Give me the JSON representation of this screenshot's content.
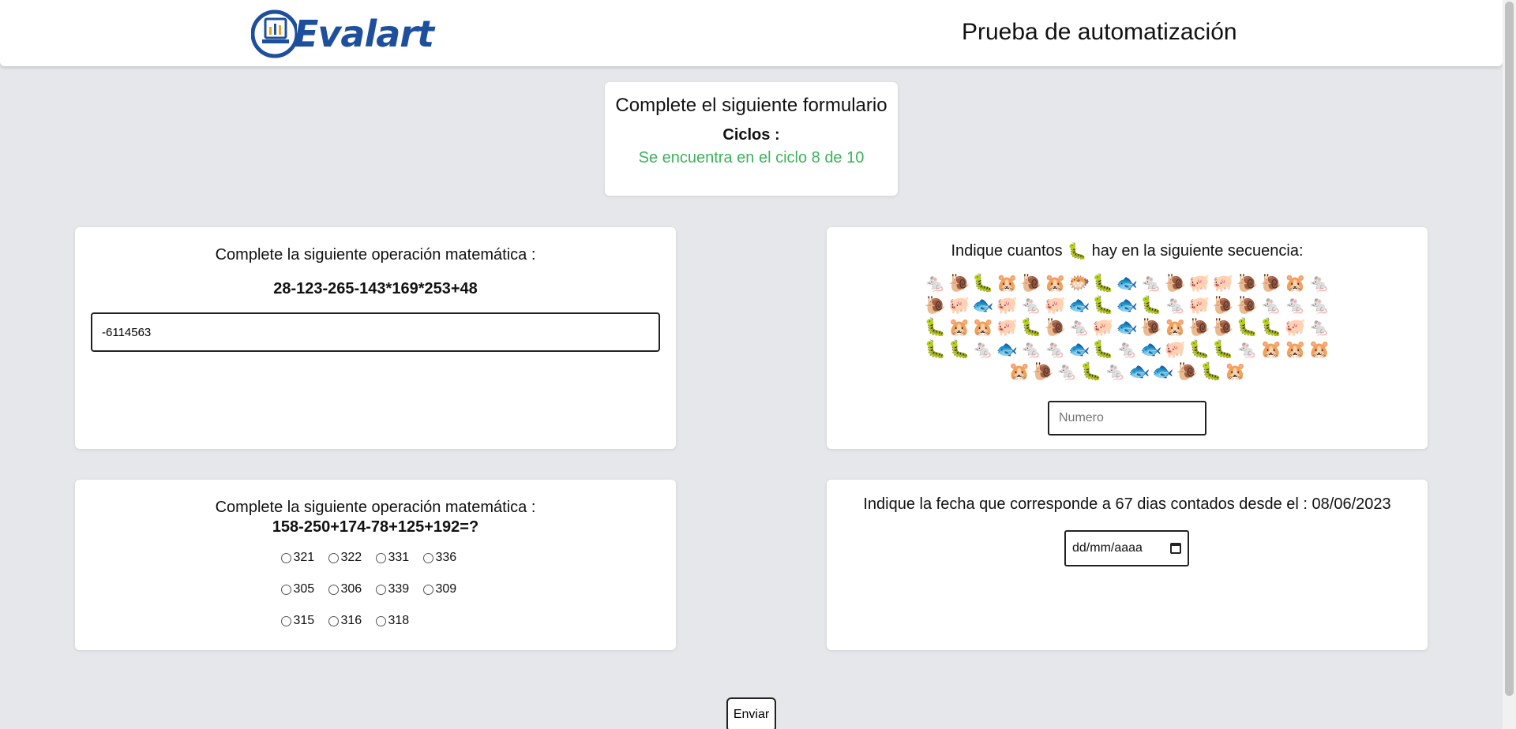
{
  "header": {
    "logo_text": "Evalart",
    "title": "Prueba de automatización"
  },
  "intro": {
    "heading": "Complete el siguiente formulario",
    "ciclos_label": "Ciclos :",
    "ciclos_status": "Se encuentra en el ciclo 8 de 10"
  },
  "math_input": {
    "prompt": "Complete la siguiente operación matemática :",
    "expression": "28-123-265-143*169*253+48",
    "value": "-6114563"
  },
  "sequence": {
    "prompt_before": "Indique cuantos",
    "prompt_icon": "🐛",
    "prompt_after": "hay en la siguiente secuencia:",
    "items": [
      "🐁",
      "🐌",
      "🐛",
      "🐹",
      "🐌",
      "🐹",
      "🐡",
      "🐛",
      "🐟",
      "🐁",
      "🐌",
      "🐖",
      "🐖",
      "🐌",
      "🐌",
      "🐹",
      "🐁",
      "🐌",
      "🐖",
      "🐟",
      "🐖",
      "🐁",
      "🐖",
      "🐟",
      "🐛",
      "🐟",
      "🐛",
      "🐁",
      "🐖",
      "🐌",
      "🐌",
      "🐁",
      "🐁",
      "🐁",
      "🐛",
      "🐹",
      "🐹",
      "🐖",
      "🐛",
      "🐌",
      "🐁",
      "🐖",
      "🐟",
      "🐌",
      "🐹",
      "🐌",
      "🐌",
      "🐛",
      "🐛",
      "🐖",
      "🐁",
      "🐛",
      "🐛",
      "🐁",
      "🐟",
      "🐁",
      "🐁",
      "🐟",
      "🐛",
      "🐁",
      "🐟",
      "🐖",
      "🐛",
      "🐛",
      "🐁",
      "🐹",
      "🐹",
      "🐹",
      "🐹",
      "🐌",
      "🐁",
      "🐛",
      "🐁",
      "🐟",
      "🐟",
      "🐌",
      "🐛",
      "🐹"
    ],
    "placeholder": "Numero"
  },
  "math_radio": {
    "prompt": "Complete la siguiente operación matemática :",
    "expression": "158-250+174-78+125+192=?",
    "options": [
      "321",
      "322",
      "331",
      "336",
      "305",
      "306",
      "339",
      "309",
      "315",
      "316",
      "318"
    ]
  },
  "date_question": {
    "prompt": "Indique la fecha que corresponde a 67 dias contados desde el : 08/06/2023",
    "placeholder": "dd/mm/aaaa"
  },
  "submit_label": "Enviar",
  "colors": {
    "accent_green": "#3cb25a",
    "logo_blue": "#1e4f9c"
  }
}
